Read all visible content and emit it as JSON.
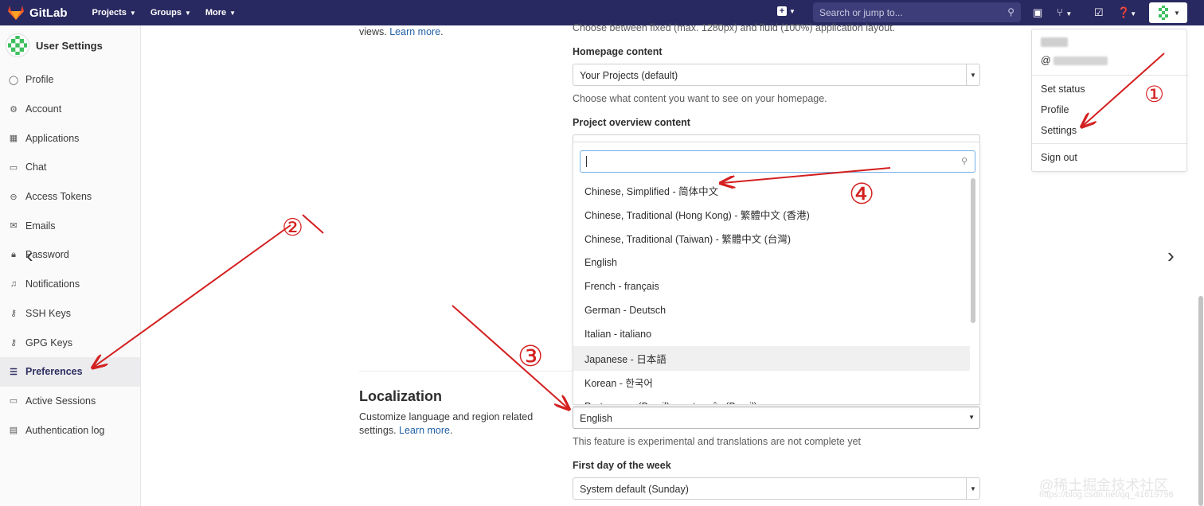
{
  "topbar": {
    "brand": "GitLab",
    "nav": [
      {
        "label": "Projects"
      },
      {
        "label": "Groups"
      },
      {
        "label": "More"
      }
    ],
    "search_placeholder": "Search or jump to..."
  },
  "sidebar": {
    "title": "User Settings",
    "items": [
      {
        "label": "Profile",
        "icon": "user-icon"
      },
      {
        "label": "Account",
        "icon": "account-icon"
      },
      {
        "label": "Applications",
        "icon": "applications-icon"
      },
      {
        "label": "Chat",
        "icon": "chat-icon"
      },
      {
        "label": "Access Tokens",
        "icon": "token-icon"
      },
      {
        "label": "Emails",
        "icon": "mail-icon"
      },
      {
        "label": "Password",
        "icon": "lock-icon"
      },
      {
        "label": "Notifications",
        "icon": "bell-icon"
      },
      {
        "label": "SSH Keys",
        "icon": "key-icon"
      },
      {
        "label": "GPG Keys",
        "icon": "key-icon"
      },
      {
        "label": "Preferences",
        "icon": "preferences-icon",
        "active": true
      },
      {
        "label": "Active Sessions",
        "icon": "monitor-icon"
      },
      {
        "label": "Authentication log",
        "icon": "log-icon"
      }
    ]
  },
  "main": {
    "top_left_text": "views.",
    "top_left_link": "Learn more",
    "layout_help": "Choose between fixed (max. 1280px) and fluid (100%) application layout.",
    "homepage": {
      "label": "Homepage content",
      "value": "Your Projects (default)",
      "help": "Choose what content you want to see on your homepage."
    },
    "project_overview": {
      "label": "Project overview content"
    },
    "localization": {
      "title": "Localization",
      "desc_line1": "Customize language and region related",
      "desc_line2": "settings.",
      "link": "Learn more",
      "language_value": "English",
      "language_help": "This feature is experimental and translations are not complete yet",
      "first_day_label": "First day of the week",
      "first_day_value": "System default (Sunday)"
    }
  },
  "language_dropdown": {
    "options": [
      "Chinese, Simplified - 简体中文",
      "Chinese, Traditional (Hong Kong) - 繁體中文 (香港)",
      "Chinese, Traditional (Taiwan) - 繁體中文 (台灣)",
      "English",
      "French - français",
      "German - Deutsch",
      "Italian - italiano",
      "Japanese - 日本語",
      "Korean - 한국어",
      "Portuguese (Brazil) - português (Brasil)"
    ],
    "highlighted": "Japanese - 日本語"
  },
  "user_menu": {
    "username_prefix": "@",
    "items": [
      "Set status",
      "Profile",
      "Settings",
      "Sign out"
    ]
  },
  "annotations": {
    "labels": [
      "①",
      "②",
      "③",
      "④"
    ],
    "color": "#d42020"
  },
  "watermark": {
    "text": "@稀土掘金技术社区",
    "sub": "https://blog.csdn.net/qq_41619796"
  },
  "colors": {
    "topbar": "#292961",
    "link": "#1f5fa7",
    "active_sidebar": "#ececef"
  }
}
